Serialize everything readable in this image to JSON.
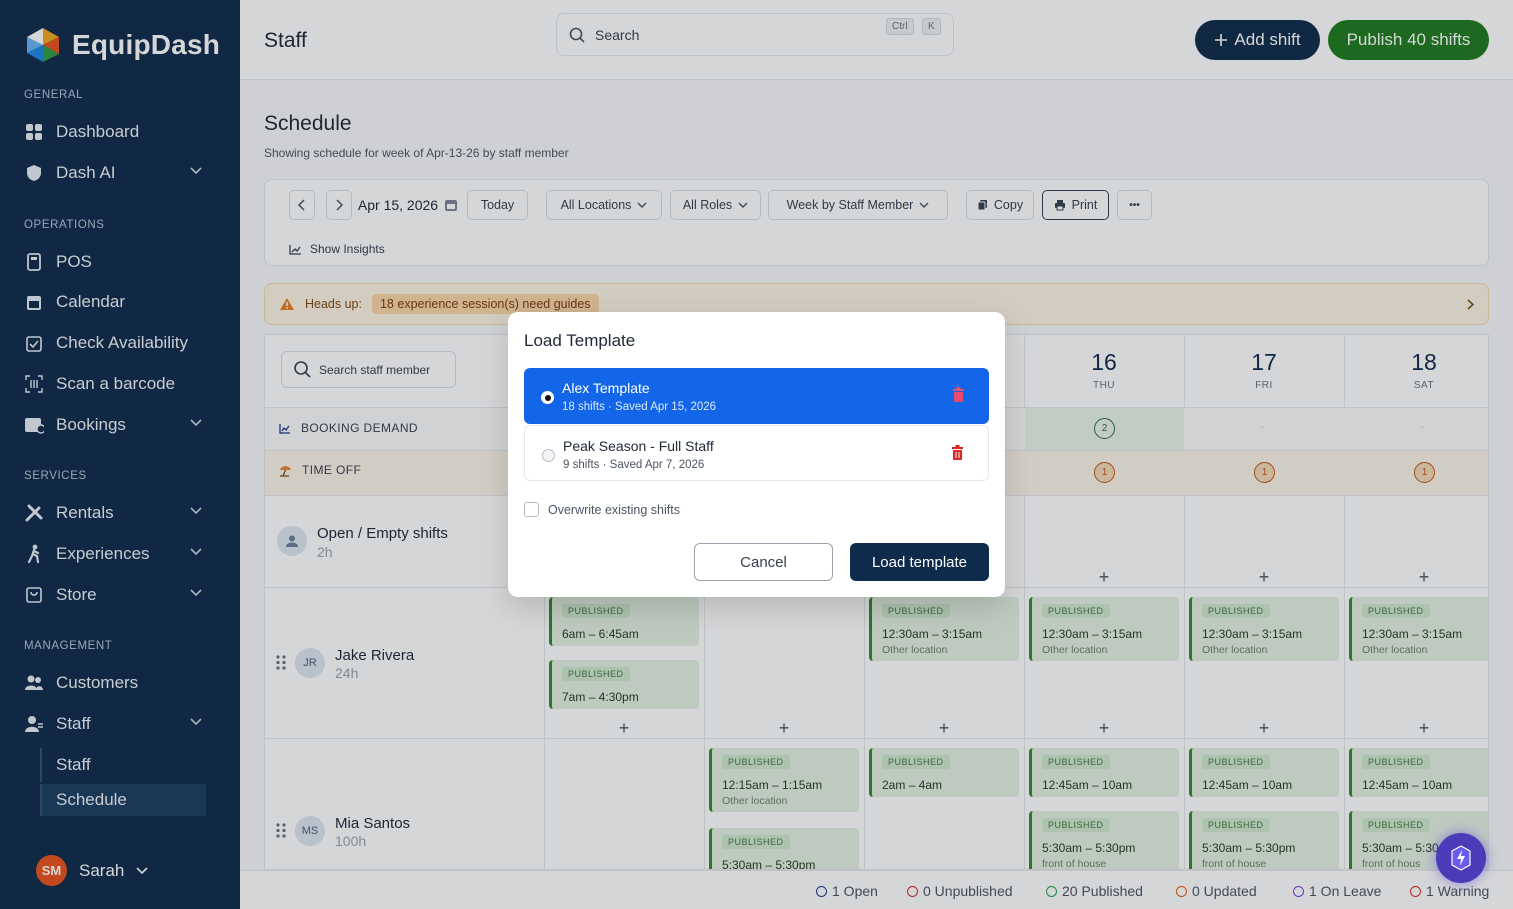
{
  "brand": {
    "name": "EquipDash"
  },
  "sidebar": {
    "sections": [
      "GENERAL",
      "OPERATIONS",
      "SERVICES",
      "MANAGEMENT"
    ],
    "items": [
      {
        "label": "Dashboard",
        "icon": "dashboard-icon"
      },
      {
        "label": "Dash AI",
        "icon": "shield-icon"
      },
      {
        "label": "POS",
        "icon": "pos-icon"
      },
      {
        "label": "Calendar",
        "icon": "calendar-icon"
      },
      {
        "label": "Check Availability",
        "icon": "calendar-check-icon"
      },
      {
        "label": "Scan a barcode",
        "icon": "barcode-icon"
      },
      {
        "label": "Bookings",
        "icon": "bookings-icon"
      },
      {
        "label": "Rentals",
        "icon": "tools-icon"
      },
      {
        "label": "Experiences",
        "icon": "hiker-icon"
      },
      {
        "label": "Store",
        "icon": "store-icon"
      },
      {
        "label": "Customers",
        "icon": "customers-icon"
      },
      {
        "label": "Staff",
        "icon": "staff-icon"
      }
    ],
    "staff_sub": [
      "Staff",
      "Schedule"
    ],
    "user": {
      "initials": "SM",
      "name": "Sarah"
    }
  },
  "header": {
    "title": "Staff",
    "search_placeholder": "Search",
    "kbd": [
      "Ctrl",
      "K"
    ],
    "add_shift": "Add shift",
    "publish": "Publish 40 shifts"
  },
  "schedule": {
    "title": "Schedule",
    "subtitle": "Showing schedule for week of Apr-13-26 by staff member",
    "toolbar": {
      "date": "Apr 15, 2026",
      "today": "Today",
      "locations": "All Locations",
      "roles": "All Roles",
      "view": "Week by Staff Member",
      "copy": "Copy",
      "print": "Print",
      "more": "•••",
      "insights": "Show Insights"
    },
    "banner": {
      "label": "Heads up:",
      "message": "18 experience session(s) need guides"
    },
    "search_staff": "Search staff member",
    "rows": {
      "booking_demand": "BOOKING DEMAND",
      "time_off": "TIME OFF"
    },
    "days": [
      {
        "num": "16",
        "name": "THU"
      },
      {
        "num": "17",
        "name": "FRI"
      },
      {
        "num": "18",
        "name": "SAT"
      }
    ],
    "demand_value": "2",
    "dash": "-",
    "timeoff_value": "1",
    "staff": [
      {
        "name": "Open / Empty shifts",
        "hours": "2h"
      },
      {
        "name": "Jake Rivera",
        "hours": "24h",
        "initials": "JR"
      },
      {
        "name": "Mia Santos",
        "hours": "100h",
        "initials": "MS"
      }
    ],
    "shift_tag": "PUBLISHED",
    "shifts": {
      "j1": {
        "time": "6am – 6:45am"
      },
      "j2": {
        "time": "7am – 4:30pm"
      },
      "j3": {
        "time": "12:30am – 3:15am",
        "loc": "Other location"
      },
      "j4": {
        "time": "12:30am – 3:15am",
        "loc": "Other location"
      },
      "j5": {
        "time": "12:30am – 3:15am",
        "loc": "Other location"
      },
      "j6": {
        "time": "12:30am – 3:15am",
        "loc": "Other location"
      },
      "m1": {
        "time": "12:15am – 1:15am",
        "loc": "Other location"
      },
      "m2": {
        "time": "2am – 4am"
      },
      "m3": {
        "time": "12:45am – 10am"
      },
      "m4": {
        "time": "12:45am – 10am"
      },
      "m5": {
        "time": "12:45am – 10am"
      },
      "m6": {
        "time": "5:30am – 5:30pm"
      },
      "m7": {
        "time": "5:30am – 5:30pm",
        "loc": "front of house"
      },
      "m8": {
        "time": "5:30am – 5:30pm",
        "loc": "front of house"
      },
      "m9": {
        "time": "5:30am – 5:30",
        "loc": "front of hous"
      }
    }
  },
  "status": [
    "1 Open",
    "0 Unpublished",
    "20 Published",
    "0 Updated",
    "1 On Leave",
    "1 Warning"
  ],
  "status_colors": [
    "#1e3a8a",
    "#dc2626",
    "#16a34a",
    "#ea580c",
    "#7c3aed",
    "#dc2626"
  ],
  "modal": {
    "title": "Load Template",
    "templates": [
      {
        "name": "Alex Template",
        "meta": "18 shifts · Saved Apr 15, 2026",
        "selected": true
      },
      {
        "name": "Peak Season - Full Staff",
        "meta": "9 shifts · Saved Apr 7, 2026",
        "selected": false
      }
    ],
    "overwrite": "Overwrite existing shifts",
    "cancel": "Cancel",
    "load": "Load template"
  },
  "colors": {
    "navy": "#0f2b4b",
    "green": "#1f7a1f",
    "blue": "#1366e8",
    "danger": "#dc2626"
  }
}
